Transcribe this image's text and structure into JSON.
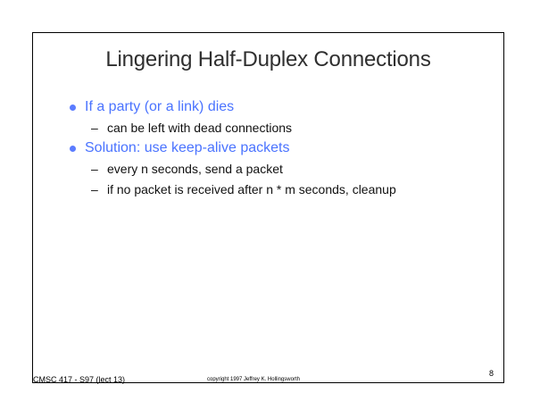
{
  "slide": {
    "title": "Lingering Half-Duplex Connections",
    "bullets": [
      {
        "text": "If a party (or a link) dies",
        "sub": [
          "can be left with dead connections"
        ]
      },
      {
        "text": "Solution: use keep-alive packets",
        "sub": [
          "every n seconds, send a packet",
          "if no packet is received after n * m seconds, cleanup"
        ]
      }
    ],
    "footer": {
      "course": "CMSC 417 - S97 (lect 13)",
      "copyright": "copyright 1997 Jeffrey K. Hollingsworth",
      "page_number": "8"
    },
    "colors": {
      "bullet_text": "#4a73ff",
      "title_text": "#2f2f2f",
      "body_text": "#111111",
      "frame": "#000000",
      "background": "#ffffff"
    }
  }
}
